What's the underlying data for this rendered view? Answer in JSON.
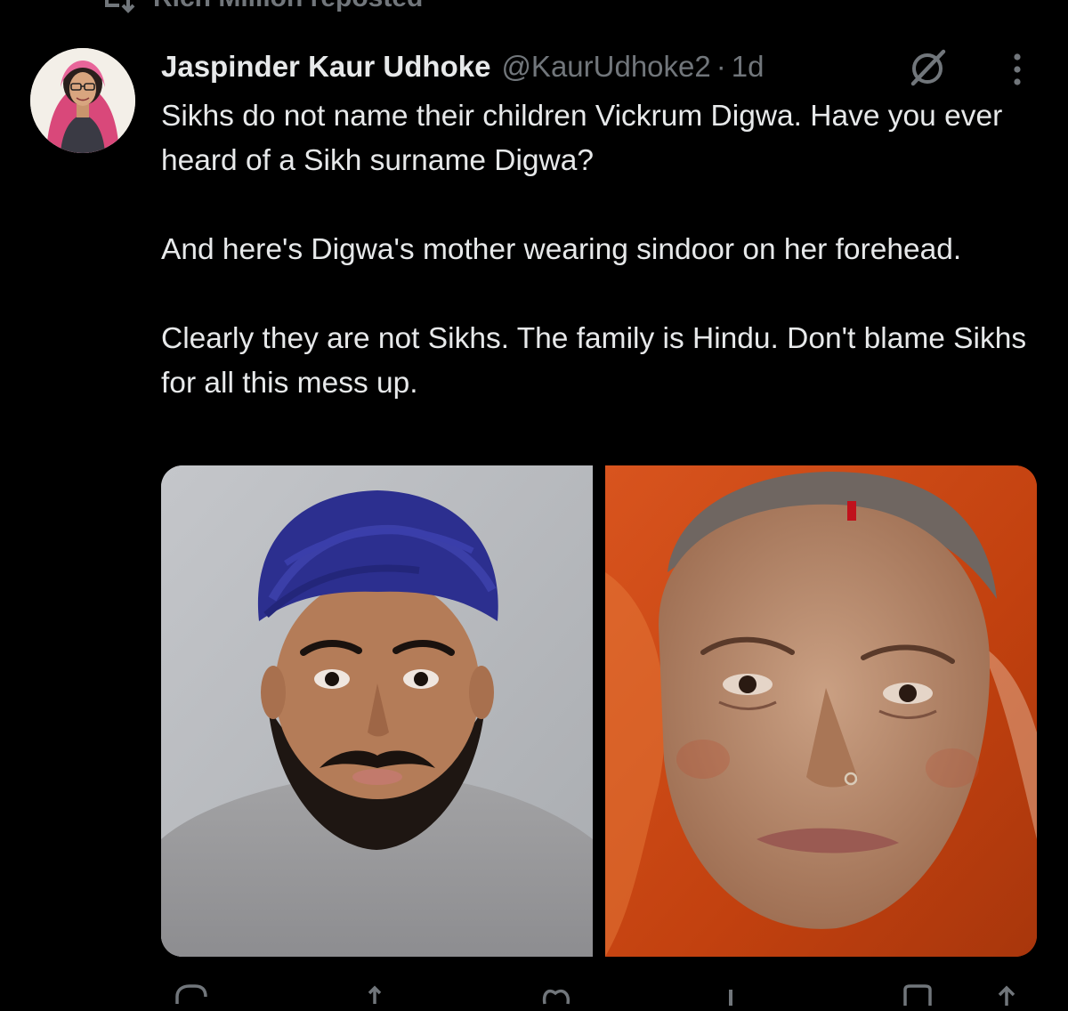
{
  "repost": {
    "label": "Rich Million reposted",
    "icon": "repost-icon"
  },
  "tweet": {
    "author": {
      "display_name": "Jaspinder Kaur Udhoke",
      "handle": "@KaurUdhoke2",
      "separator": "·",
      "time": "1d"
    },
    "paragraphs": [
      "Sikhs do not name their children Vickrum Digwa. Have you ever heard of a Sikh surname Digwa?",
      "And here's Digwa's mother wearing sindoor on her forehead.",
      "Clearly they are not Sikhs. The family is Hindu. Don't blame Sikhs for all this mess up."
    ],
    "media": [
      {
        "icon": "photo-man-blue-turban"
      },
      {
        "icon": "photo-woman-orange-headscarf"
      }
    ]
  },
  "icons": {
    "grok": "grok-icon",
    "more": "more-options-icon",
    "reply": "reply-icon",
    "retweet": "retweet-icon",
    "like": "like-icon",
    "views": "views-icon",
    "bookmark": "bookmark-icon",
    "share": "share-icon"
  },
  "colors": {
    "background": "#000000",
    "text": "#e7e9ea",
    "muted": "#71767b"
  }
}
